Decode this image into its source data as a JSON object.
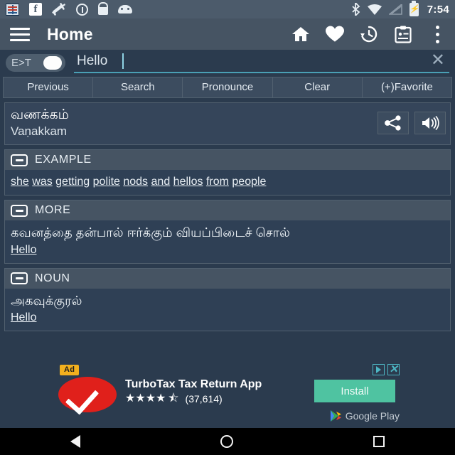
{
  "statusbar": {
    "time": "7:54",
    "left_icons": [
      {
        "name": "dictionary-app-icon"
      },
      {
        "name": "facebook-icon",
        "glyph": "f"
      },
      {
        "name": "airplane-fm-icon"
      },
      {
        "name": "info-circle-icon"
      },
      {
        "name": "lock-icon"
      },
      {
        "name": "android-robot-icon"
      }
    ],
    "right_icons": [
      {
        "name": "bluetooth-icon"
      },
      {
        "name": "wifi-icon"
      },
      {
        "name": "signal-icon"
      },
      {
        "name": "battery-charging-icon"
      }
    ]
  },
  "appbar": {
    "menu_icon": "hamburger-menu-icon",
    "title": "Home",
    "actions": [
      {
        "name": "home-icon"
      },
      {
        "name": "favorites-heart-icon"
      },
      {
        "name": "history-icon"
      },
      {
        "name": "quiz-clipboard-icon"
      },
      {
        "name": "overflow-menu-icon"
      }
    ]
  },
  "search": {
    "direction_toggle_label": "E>T",
    "direction_toggle_state": "on",
    "value": "Hello",
    "placeholder": "Hello",
    "clear_glyph": "✕"
  },
  "buttons": [
    {
      "label": "Previous",
      "name": "previous-button"
    },
    {
      "label": "Search",
      "name": "search-button"
    },
    {
      "label": "Pronounce",
      "name": "pronounce-button"
    },
    {
      "label": "Clear",
      "name": "clear-button"
    },
    {
      "label": "(+)Favorite",
      "name": "add-favorite-button"
    }
  ],
  "result": {
    "word_native": "வணக்கம்",
    "transliteration": "Vaṇakkam",
    "share_label": "share-icon",
    "speak_label": "speaker-icon"
  },
  "sections": [
    {
      "name": "example",
      "title": "EXAMPLE",
      "collapsed": false,
      "example_words": [
        "she",
        "was",
        "getting",
        "polite",
        "nods",
        "and",
        "hellos",
        "from",
        "people"
      ]
    },
    {
      "name": "more",
      "title": "MORE",
      "collapsed": false,
      "native": "கவனத்தை தன்பால் ஈர்க்கும் வியப்பிடைச் சொல்",
      "link": "Hello"
    },
    {
      "name": "noun",
      "title": "NOUN",
      "collapsed": false,
      "native": "அகவுக்குரல்",
      "link": "Hello"
    }
  ],
  "ad": {
    "badge": "Ad",
    "title": "TurboTax Tax Return App",
    "stars": "★★★★",
    "half_star": "⯪",
    "rating_count": "(37,614)",
    "install_label": "Install",
    "store_label": "Google Play",
    "adchoices_icon": "adchoices-icon",
    "close_glyph": "✕"
  },
  "navbar": {
    "back": "back-nav-button",
    "home": "home-nav-button",
    "recents": "recents-nav-button"
  },
  "colors": {
    "background": "#2b3b4e",
    "appbar": "#465463",
    "statusbar": "#4c5b6b",
    "accent": "#4aa0b5",
    "install": "#4fc3a1",
    "ad_badge": "#f2b01e"
  }
}
